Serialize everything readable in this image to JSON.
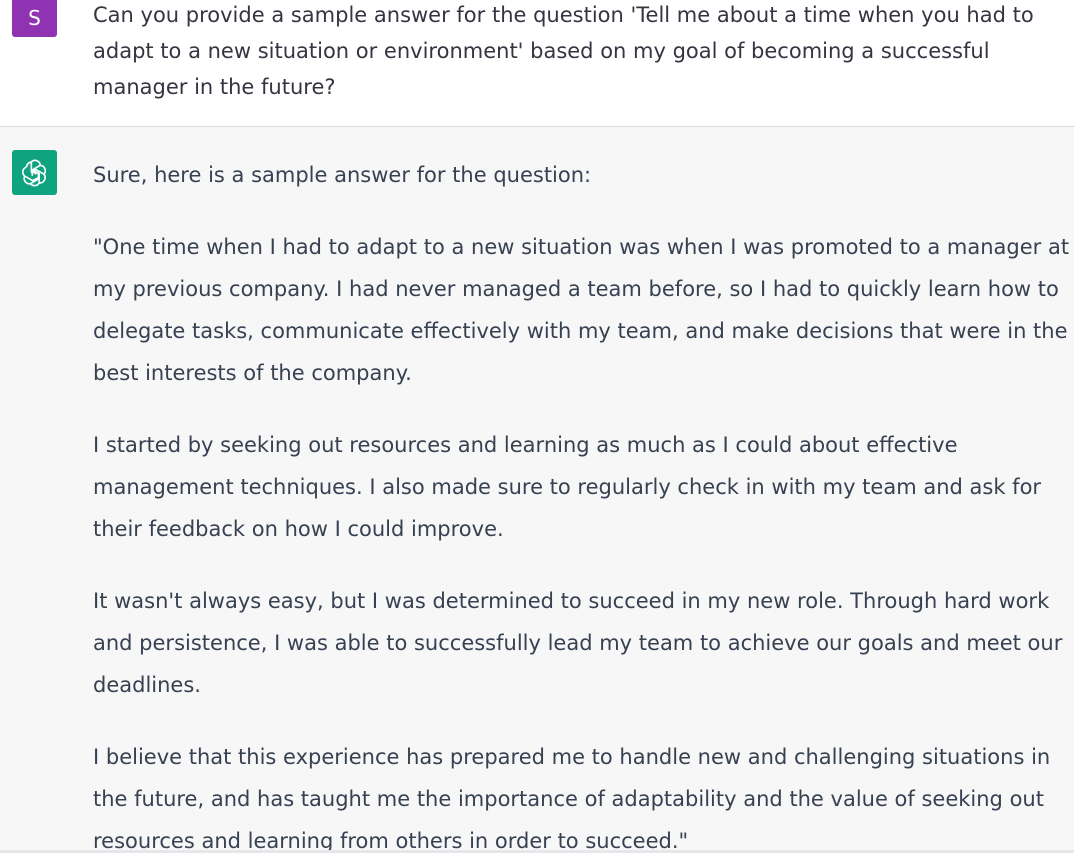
{
  "user_message": {
    "avatar_letter": "S",
    "lines": [
      "Can you provide a sample answer for the question 'Tell me about a time when you had to",
      "adapt to a new situation or environment' based on my goal of becoming a successful",
      "manager in the future?"
    ]
  },
  "assistant_message": {
    "avatar_icon": "openai-logo-icon",
    "paragraphs": [
      [
        "Sure, here is a sample answer for the question:"
      ],
      [
        "\"One time when I had to adapt to a new situation was when I was promoted to a manager at",
        "my previous company. I had never managed a team before, so I had to quickly learn how to",
        "delegate tasks, communicate effectively with my team, and make decisions that were in the",
        "best interests of the company."
      ],
      [
        "I started by seeking out resources and learning as much as I could about effective",
        "management techniques. I also made sure to regularly check in with my team and ask for",
        "their feedback on how I could improve."
      ],
      [
        "It wasn't always easy, but I was determined to succeed in my new role. Through hard work",
        "and persistence, I was able to successfully lead my team to achieve our goals and meet our",
        "deadlines."
      ],
      [
        "I believe that this experience has prepared me to handle new and challenging situations in",
        "the future, and has taught me the importance of adaptability and the value of seeking out",
        "resources and learning from others in order to succeed.\""
      ]
    ]
  },
  "colors": {
    "user_avatar": "#9033b3",
    "assistant_avatar": "#10a37f",
    "user_bg": "#ffffff",
    "assistant_bg": "#f7f7f8"
  }
}
